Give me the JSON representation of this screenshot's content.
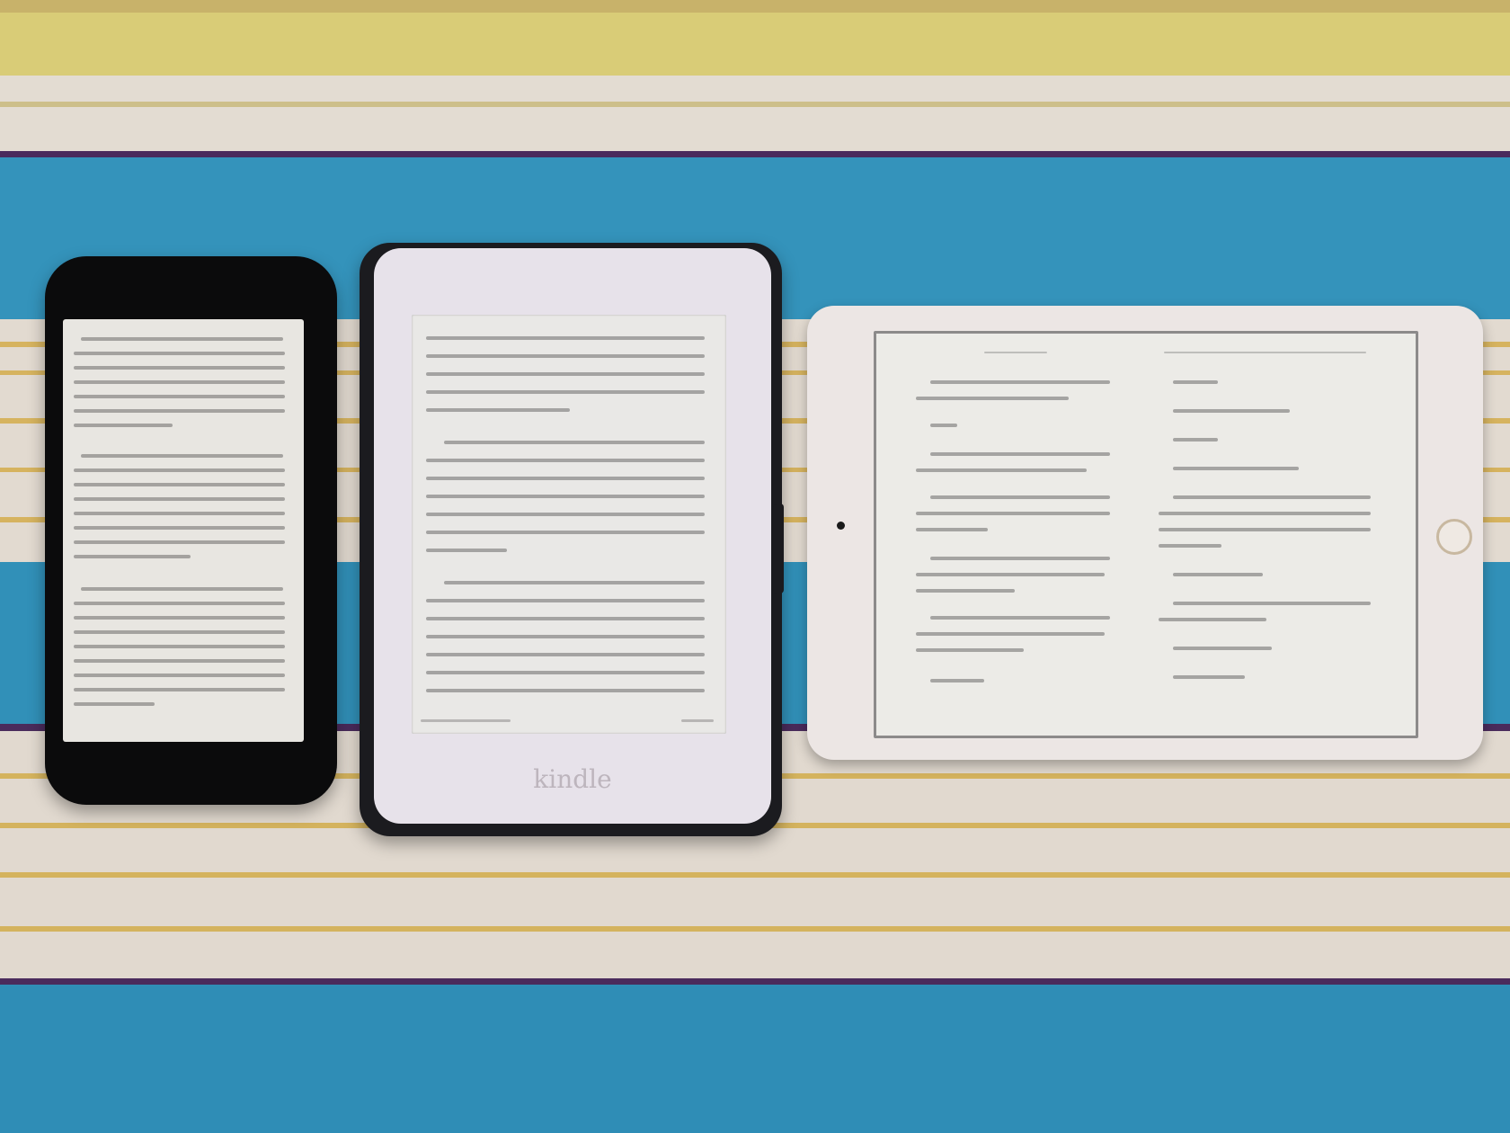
{
  "devices": {
    "kindle": {
      "logo_text": "kindle"
    }
  },
  "colors": {
    "blanket_blue": "#2f8fb7",
    "blanket_cream": "#e5ddd1",
    "stripe_yellow": "#d7c46a",
    "stripe_purple": "#4a2b5c",
    "device_black": "#0b0b0c",
    "kindle_white": "#e7e2ea",
    "ipad_silver": "#ece6e4",
    "screen_paper": "#e9e8e6"
  }
}
